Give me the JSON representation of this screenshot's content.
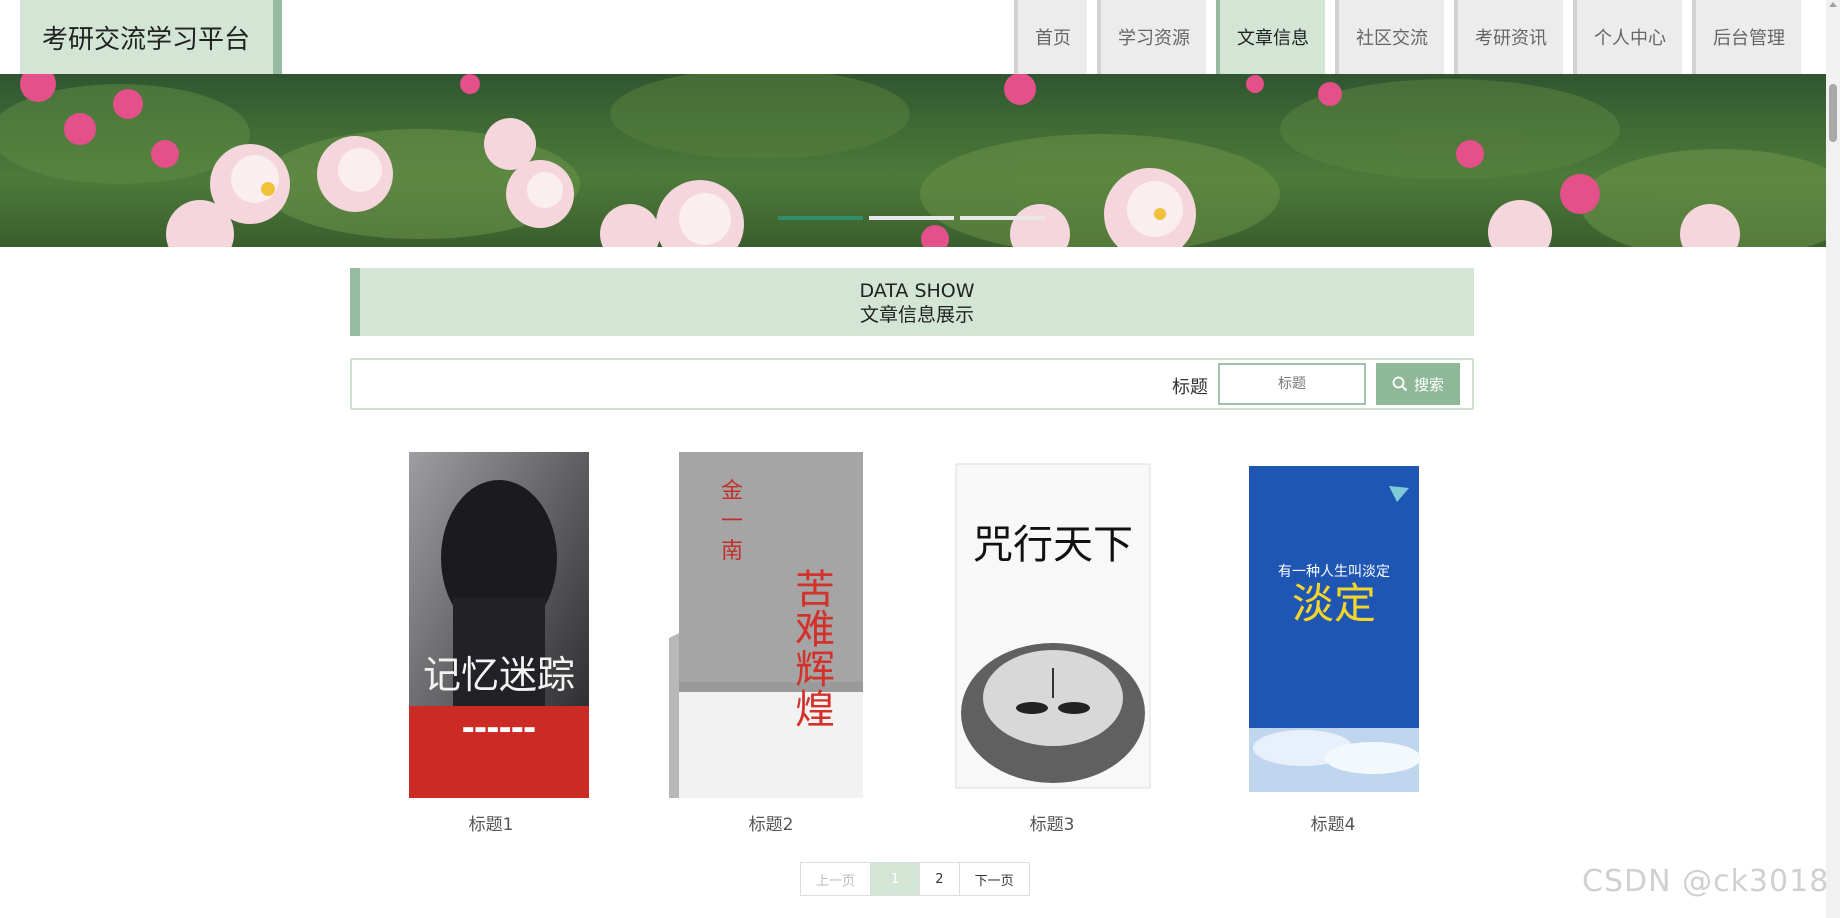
{
  "app": {
    "title": "考研交流学习平台"
  },
  "nav": {
    "items": [
      {
        "label": "首页",
        "active": false
      },
      {
        "label": "学习资源",
        "active": false
      },
      {
        "label": "文章信息",
        "active": true
      },
      {
        "label": "社区交流",
        "active": false
      },
      {
        "label": "考研资讯",
        "active": false
      },
      {
        "label": "个人中心",
        "active": false
      },
      {
        "label": "后台管理",
        "active": false
      }
    ]
  },
  "banner": {
    "slide_count": 3,
    "active_slide": 1
  },
  "section": {
    "title_en": "DATA SHOW",
    "title_cn": "文章信息展示"
  },
  "search": {
    "label": "标题",
    "placeholder": "标题",
    "button_label": "搜索"
  },
  "articles": [
    {
      "title": "标题1",
      "cover_text": "记忆迷踪"
    },
    {
      "title": "标题2",
      "cover_text": "苦难辉煌"
    },
    {
      "title": "标题3",
      "cover_text": "咒行天下"
    },
    {
      "title": "标题4",
      "cover_text": "有一种人生叫淡定"
    }
  ],
  "pagination": {
    "prev": "上一页",
    "pages": [
      "1",
      "2"
    ],
    "current": "1",
    "next": "下一页"
  },
  "watermark": "CSDN @ck3018",
  "colors": {
    "accent": "#d3e5d5",
    "accent_dark": "#97bb9f",
    "button": "#8fb898",
    "slider_active": "#2f8f6b"
  }
}
